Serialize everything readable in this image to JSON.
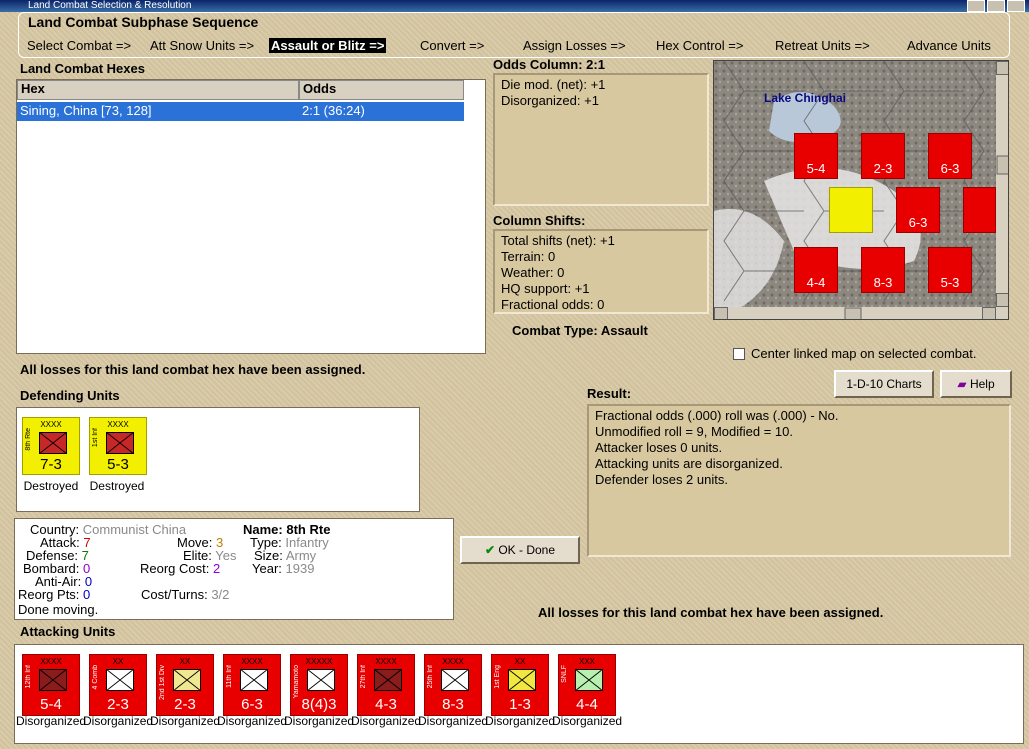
{
  "window": {
    "title": "Land Combat Selection & Resolution"
  },
  "sequence": {
    "title": "Land Combat Subphase Sequence",
    "steps": [
      "Select Combat =>",
      "Att Snow Units =>",
      "Assault or Blitz =>",
      "Convert =>",
      "Assign Losses =>",
      "Hex Control =>",
      "Retreat Units =>",
      "Advance Units"
    ],
    "active_index": 2
  },
  "hexes": {
    "title": "Land Combat Hexes",
    "columns": [
      "Hex",
      "Odds"
    ],
    "rows": [
      {
        "hex": "Sining, China [73, 128]",
        "odds": "2:1 (36:24)"
      }
    ]
  },
  "odds": {
    "title": "Odds Column: 2:1",
    "lines": [
      "Die mod. (net): +1",
      "Disorganized: +1"
    ]
  },
  "shifts": {
    "title": "Column Shifts:",
    "lines": [
      "Total shifts (net): +1",
      "Terrain: 0",
      "Weather: 0",
      "HQ support: +1",
      "Fractional odds: 0"
    ]
  },
  "combat_type": "Combat Type:  Assault",
  "map": {
    "label": "Lake Chinghai"
  },
  "center_linked": "Center linked map on selected combat.",
  "losses_msg": "All losses for this land combat hex have been assigned.",
  "buttons": {
    "charts": "1-D-10 Charts",
    "help": "Help",
    "ok": "OK - Done"
  },
  "defending": {
    "title": "Defending Units",
    "units": [
      {
        "name": "8th Rte",
        "size": "XXXX",
        "value": "7-3",
        "status": "Destroyed"
      },
      {
        "name": "1st Inf",
        "size": "XXXX",
        "value": "5-3",
        "status": "Destroyed"
      }
    ]
  },
  "result": {
    "title": "Result:",
    "lines": [
      "Fractional odds (.000) roll was (.000)  - No.",
      "Unmodified roll = 9, Modified = 10.",
      "Attacker loses 0 units.",
      "Attacking units are disorganized.",
      "Defender loses 2 units."
    ]
  },
  "info": {
    "country_label": "Country:",
    "country": "Communist China",
    "attack_label": "Attack:",
    "attack": "7",
    "defense_label": "Defense:",
    "defense": "7",
    "bombard_label": "Bombard:",
    "bombard": "0",
    "antiair_label": "Anti-Air:",
    "antiair": "0",
    "reorgpts_label": "Reorg Pts:",
    "reorgpts": "0",
    "done": "Done moving.",
    "move_label": "Move:",
    "move": "3",
    "elite_label": "Elite:",
    "elite": "Yes",
    "reorgcost_label": "Reorg Cost:",
    "reorgcost": "2",
    "costturns_label": "Cost/Turns:",
    "costturns": "3/2",
    "name_label": "Name:",
    "name": "8th Rte",
    "type_label": "Type:",
    "type": "Infantry",
    "size_label": "Size:",
    "size": "Army",
    "year_label": "Year:",
    "year": "1939"
  },
  "attacking": {
    "title": "Attacking Units",
    "units": [
      {
        "name": "12th Inf",
        "size": "XXXX",
        "value": "5-4",
        "status": "Disorganized",
        "kind": "inf"
      },
      {
        "name": "4 Comb",
        "size": "XX",
        "value": "2-3",
        "status": "Disorganized",
        "kind": "para"
      },
      {
        "name": "2nd 1st Div",
        "size": "XX",
        "value": "2-3",
        "status": "Disorganized",
        "kind": "cav"
      },
      {
        "name": "11th Inf",
        "size": "XXXX",
        "value": "6-3",
        "status": "Disorganized",
        "kind": "inf2"
      },
      {
        "name": "Yamamoto",
        "size": "XXXXX",
        "value": "8(4)3",
        "status": "Disorganized",
        "kind": "inf2"
      },
      {
        "name": "27th Inf",
        "size": "XXXX",
        "value": "4-3",
        "status": "Disorganized",
        "kind": "inf"
      },
      {
        "name": "25th Inf",
        "size": "XXXX",
        "value": "8-3",
        "status": "Disorganized",
        "kind": "inf2"
      },
      {
        "name": "1st Eng",
        "size": "XX",
        "value": "1-3",
        "status": "Disorganized",
        "kind": "eng"
      },
      {
        "name": "SNLF",
        "size": "XXX",
        "value": "4-4",
        "status": "Disorganized",
        "kind": "marine"
      }
    ]
  },
  "colors": {
    "counter_red": "#e80000",
    "counter_yellow": "#f2f000",
    "selection_blue": "#2a72d8"
  }
}
